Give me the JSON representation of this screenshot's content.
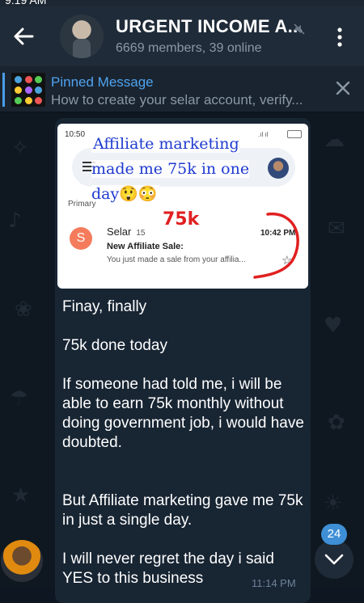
{
  "header": {
    "title": "URGENT INCOME A...",
    "subtitle": "6669 members, 39 online",
    "status_time": "9:19 AM"
  },
  "pinned": {
    "title": "Pinned Message",
    "text": "How to create your selar account, verify..."
  },
  "message": {
    "image": {
      "time": "10:50",
      "headline": "Affiliate marketing made me 75k in one day😲😳",
      "primary_label": "Primary",
      "amount_annotation": "75k",
      "sender_initial": "S",
      "sender": "Selar",
      "sender_count": "15",
      "mail_time": "10:42 PM",
      "subject": "New Affiliate Sale:",
      "preview": "You just made a sale from your affilia..."
    },
    "paragraphs": [
      "Finay, finally",
      "75k done today",
      "If someone had told me, i will be able to earn 75k monthly without doing government job, i would have doubted.",
      "But Affiliate marketing gave me 75k in just a single day.",
      "I will never regret the day i said YES to this business"
    ],
    "time": "11:14 PM"
  },
  "scroll": {
    "unread_count": "24"
  },
  "colors": {
    "header_bg": "#1f2b38",
    "chat_bg": "#0f1820",
    "bubble_bg": "#182533",
    "accent": "#4fa3f0",
    "badge": "#3e8fd6"
  }
}
